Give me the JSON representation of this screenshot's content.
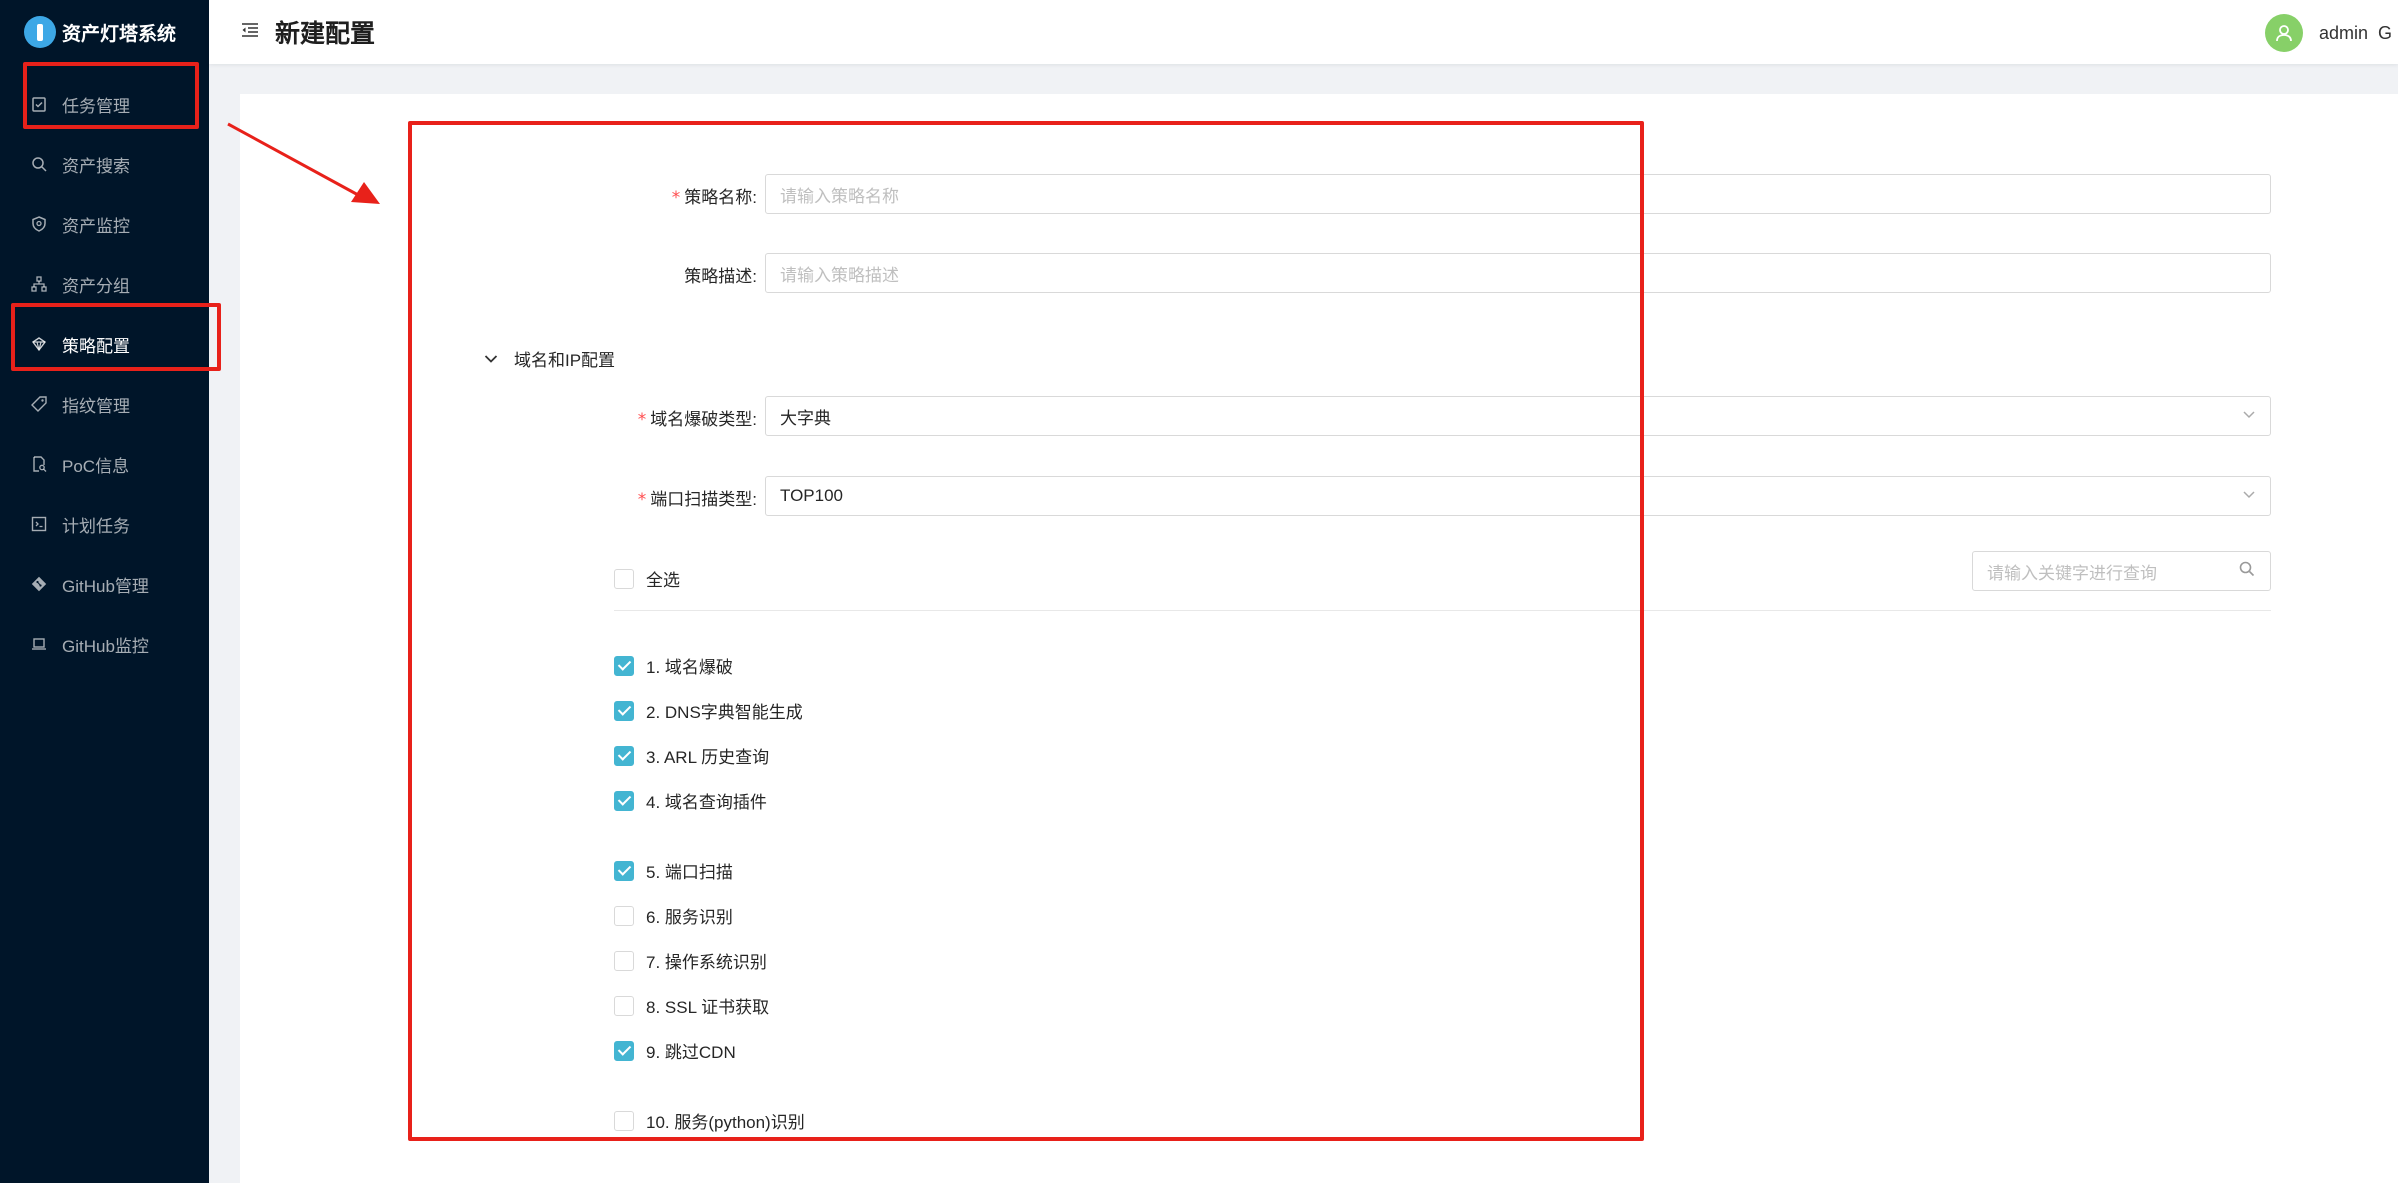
{
  "app": {
    "title": "资产灯塔系统"
  },
  "sidebar": {
    "items": [
      {
        "label": "任务管理",
        "icon": "task-icon"
      },
      {
        "label": "资产搜索",
        "icon": "search-icon"
      },
      {
        "label": "资产监控",
        "icon": "monitor-icon"
      },
      {
        "label": "资产分组",
        "icon": "cluster-icon"
      },
      {
        "label": "策略配置",
        "icon": "policy-icon"
      },
      {
        "label": "指纹管理",
        "icon": "fingerprint-icon"
      },
      {
        "label": "PoC信息",
        "icon": "file-search-icon"
      },
      {
        "label": "计划任务",
        "icon": "code-icon"
      },
      {
        "label": "GitHub管理",
        "icon": "github-icon"
      },
      {
        "label": "GitHub监控",
        "icon": "laptop-icon"
      }
    ]
  },
  "header": {
    "title": "新建配置",
    "user": "admin",
    "trailing": "G"
  },
  "form": {
    "name_label": "策略名称:",
    "name_placeholder": "请输入策略名称",
    "desc_label": "策略描述:",
    "desc_placeholder": "请输入策略描述",
    "section_title": "域名和IP配置",
    "domain_brute_label": "域名爆破类型:",
    "domain_brute_value": "大字典",
    "port_scan_label": "端口扫描类型:",
    "port_scan_value": "TOP100",
    "select_all_label": "全选",
    "keyword_placeholder": "请输入关键字进行查询",
    "options": [
      {
        "label": "1. 域名爆破",
        "checked": true
      },
      {
        "label": "2. DNS字典智能生成",
        "checked": true
      },
      {
        "label": "3. ARL 历史查询",
        "checked": true
      },
      {
        "label": "4. 域名查询插件",
        "checked": true
      },
      {
        "label": "5. 端口扫描",
        "checked": true
      },
      {
        "label": "6. 服务识别",
        "checked": false
      },
      {
        "label": "7. 操作系统识别",
        "checked": false
      },
      {
        "label": "8. SSL 证书获取",
        "checked": false
      },
      {
        "label": "9. 跳过CDN",
        "checked": true
      },
      {
        "label": "10. 服务(python)识别",
        "checked": false
      }
    ]
  },
  "colors": {
    "sidebar_bg": "#001529",
    "checkbox_checked": "#43b5d2",
    "required": "#ff4d4f",
    "annotation": "#e8211a"
  }
}
